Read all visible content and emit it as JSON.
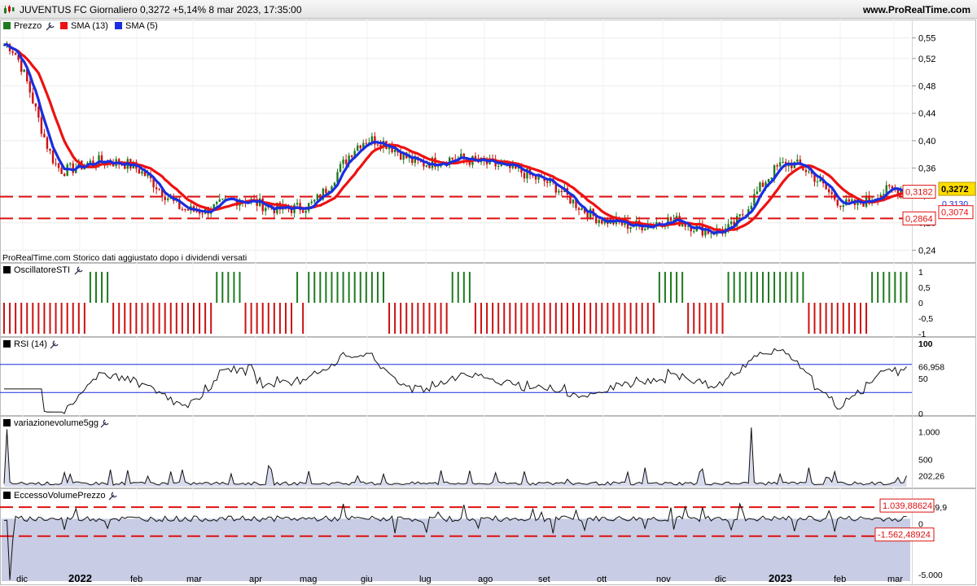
{
  "header": {
    "title": "JUVENTUS FC Giornaliero 0,3272 +5,14% 8 mar 2023, 17:35:00",
    "site": "www.ProRealTime.com"
  },
  "price_panel": {
    "legend": [
      "Prezzo",
      "SMA (13)",
      "SMA (5)"
    ],
    "note": "ProRealTime.com  Storico dati aggiustato dopo i dividendi versati",
    "last_price_label": "0,3272",
    "sma5_label": "0,3130",
    "upper_level_label": "0,3182",
    "sma13_label": "0,3074",
    "lower_level_label": "0,2864"
  },
  "sti_panel": {
    "legend": "OscillatoreSTI",
    "axis_labels": [
      "1",
      "0,5",
      "0",
      "-0,5",
      "-1"
    ]
  },
  "rsi_panel": {
    "legend": "RSI (14)",
    "axis_labels": [
      "100",
      "66,958",
      "50",
      "0"
    ]
  },
  "vol_panel": {
    "legend": "variazionevolume5gg",
    "axis_labels": [
      "1.000",
      "500",
      "202,26"
    ]
  },
  "ecc_panel": {
    "legend": "EccessoVolumePrezzo",
    "axis_labels": [
      "1.039,9",
      "0",
      "-5.000"
    ],
    "upper_level_label": "1.039,88624",
    "lower_level_label": "-1.562,48924"
  },
  "x_axis": [
    "dic",
    "2022",
    "feb",
    "mar",
    "apr",
    "mag",
    "giu",
    "lug",
    "ago",
    "set",
    "ott",
    "nov",
    "dic",
    "2023",
    "feb",
    "mar"
  ],
  "colors": {
    "sma13": "#ee1111",
    "sma5": "#1a2ee0",
    "up_bar": "#1f7a1f",
    "down_bar": "#cc1111",
    "level_line": "#dd1111",
    "panel_fill": "#c8cce4"
  },
  "chart_data": {
    "type": "line",
    "title": "JUVENTUS FC Giornaliero",
    "x": [
      "dic 2021",
      "2022",
      "feb",
      "mar",
      "apr",
      "mag",
      "giu",
      "lug",
      "ago",
      "set",
      "ott",
      "nov",
      "dic",
      "2023",
      "feb",
      "mar"
    ],
    "series": [
      {
        "name": "Prezzo",
        "values": [
          0.54,
          0.36,
          0.37,
          0.3,
          0.31,
          0.3,
          0.4,
          0.37,
          0.37,
          0.34,
          0.28,
          0.28,
          0.27,
          0.37,
          0.31,
          0.327
        ]
      },
      {
        "name": "SMA (13)",
        "values": [
          0.55,
          0.4,
          0.36,
          0.33,
          0.32,
          0.31,
          0.37,
          0.37,
          0.36,
          0.34,
          0.29,
          0.28,
          0.28,
          0.35,
          0.31,
          0.31
        ]
      },
      {
        "name": "SMA (5)",
        "values": [
          0.54,
          0.36,
          0.37,
          0.31,
          0.31,
          0.3,
          0.39,
          0.37,
          0.37,
          0.34,
          0.28,
          0.28,
          0.26,
          0.36,
          0.31,
          0.313
        ]
      }
    ],
    "levels": [
      0.3182,
      0.2864
    ],
    "last": 0.3272,
    "change_pct": 5.14,
    "y_ticks": [
      0.24,
      0.28,
      0.32,
      0.36,
      0.4,
      0.44,
      0.48,
      0.52,
      0.55
    ],
    "ylim": [
      0.225,
      0.565
    ],
    "indicators": {
      "rsi_last": 66.958,
      "variazionevolume5gg_last": 202.26,
      "eccesso_volume_prezzo_levels": [
        1039.88624,
        -1562.48924
      ]
    }
  }
}
